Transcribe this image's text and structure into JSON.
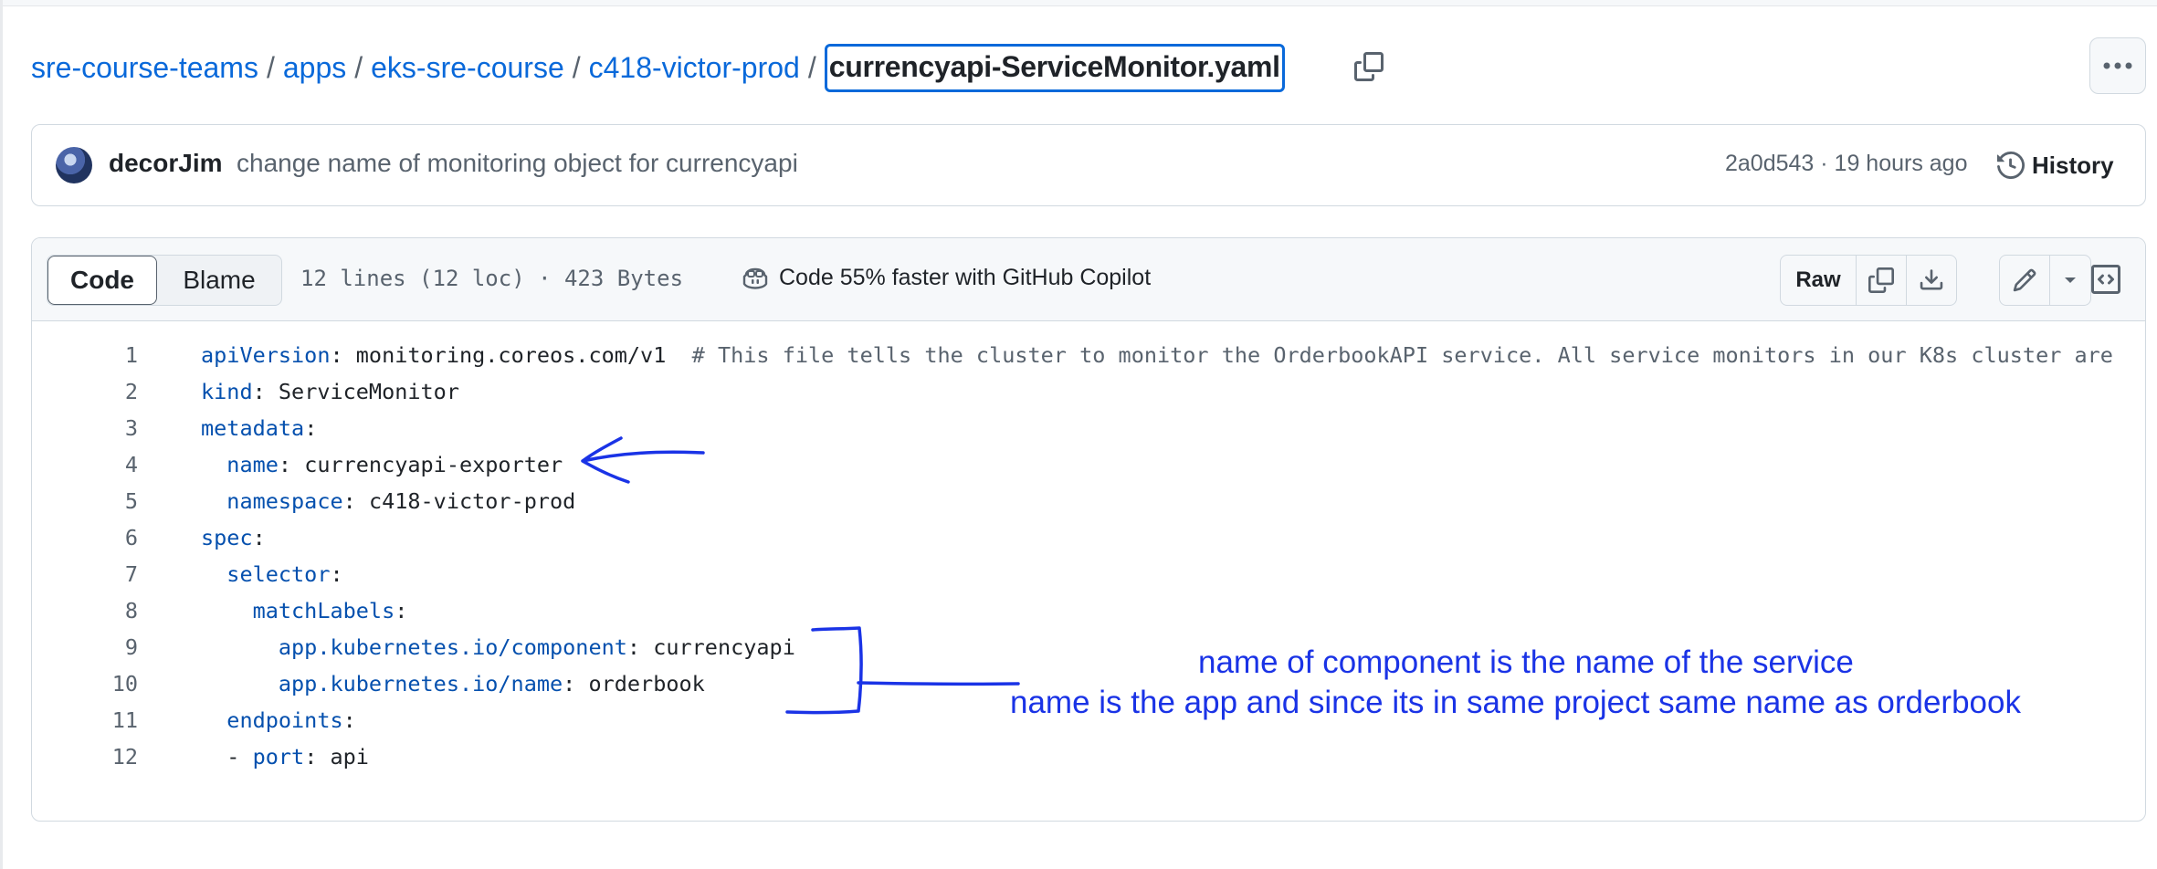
{
  "breadcrumb": {
    "items": [
      "sre-course-teams",
      "apps",
      "eks-sre-course",
      "c418-victor-prod"
    ],
    "separator": "/",
    "current_file": "currencyapi-ServiceMonitor.yaml"
  },
  "commit": {
    "author": "decorJim",
    "message": "change name of monitoring object for currencyapi",
    "meta": "2a0d543 · 19 hours ago",
    "history_label": "History"
  },
  "file_header": {
    "tabs": [
      {
        "label": "Code",
        "selected": true
      },
      {
        "label": "Blame",
        "selected": false
      }
    ],
    "info": "12 lines (12 loc) · 423 Bytes",
    "copilot_label": "Code 55% faster with GitHub Copilot",
    "raw_label": "Raw"
  },
  "code_lines": [
    {
      "n": "1",
      "indent": "",
      "key": "apiVersion",
      "value": " monitoring.coreos.com/v1",
      "comment": "  # This file tells the cluster to monitor the OrderbookAPI service. All service monitors in our K8s cluster are",
      "dash": ""
    },
    {
      "n": "2",
      "indent": "",
      "key": "kind",
      "value": " ServiceMonitor",
      "comment": "",
      "dash": ""
    },
    {
      "n": "3",
      "indent": "",
      "key": "metadata",
      "value": "",
      "comment": "",
      "dash": ""
    },
    {
      "n": "4",
      "indent": "  ",
      "key": "name",
      "value": " currencyapi-exporter",
      "comment": "",
      "dash": ""
    },
    {
      "n": "5",
      "indent": "  ",
      "key": "namespace",
      "value": " c418-victor-prod",
      "comment": "",
      "dash": ""
    },
    {
      "n": "6",
      "indent": "",
      "key": "spec",
      "value": "",
      "comment": "",
      "dash": ""
    },
    {
      "n": "7",
      "indent": "  ",
      "key": "selector",
      "value": "",
      "comment": "",
      "dash": ""
    },
    {
      "n": "8",
      "indent": "    ",
      "key": "matchLabels",
      "value": "",
      "comment": "",
      "dash": ""
    },
    {
      "n": "9",
      "indent": "      ",
      "key": "app.kubernetes.io/component",
      "value": " currencyapi",
      "comment": "",
      "dash": ""
    },
    {
      "n": "10",
      "indent": "      ",
      "key": "app.kubernetes.io/name",
      "value": " orderbook",
      "comment": "",
      "dash": ""
    },
    {
      "n": "11",
      "indent": "  ",
      "key": "endpoints",
      "value": "",
      "comment": "",
      "dash": ""
    },
    {
      "n": "12",
      "indent": "  ",
      "key": "port",
      "value": " api",
      "comment": "",
      "dash": "- "
    }
  ],
  "annotations": {
    "line1": "name of component is the name of the service",
    "line2": "name is the app and since its in same project same name as orderbook",
    "color": "#1a33e6"
  },
  "colors": {
    "link": "#0969da",
    "yaml_key": "#0550ae",
    "muted": "#59636e"
  }
}
